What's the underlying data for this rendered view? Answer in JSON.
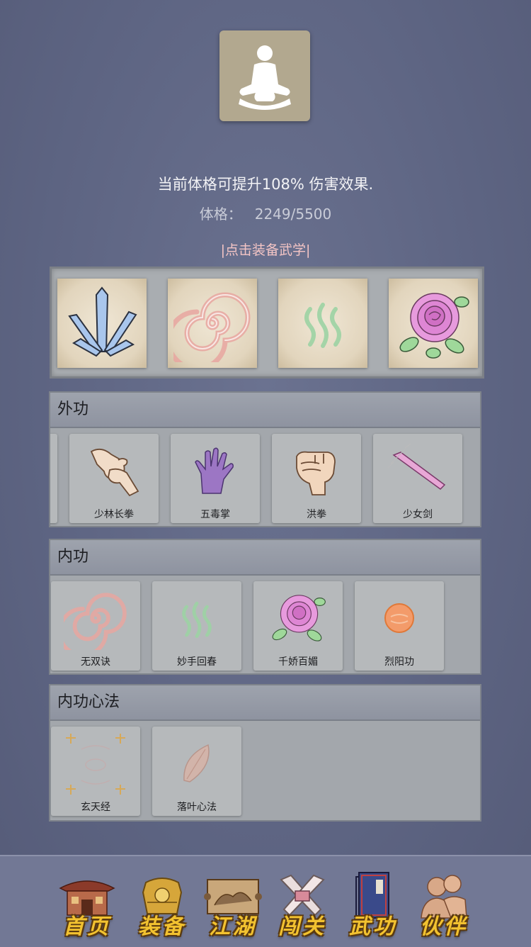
{
  "header": {
    "avatar_icon": "meditation-figure-icon",
    "description": "当前体格可提升108% 伤害效果.",
    "stat_label": "体格：",
    "stat_value": "2249/5500",
    "equip_hint": "|点击装备武学|"
  },
  "equipped_slots": [
    {
      "icon": "crystal-blades-icon"
    },
    {
      "icon": "swirl-icon"
    },
    {
      "icon": "green-waves-icon"
    },
    {
      "icon": "rose-icon"
    }
  ],
  "sections": {
    "waigong": {
      "title": "外功",
      "items": [
        {
          "name": "少林长拳",
          "icon": "grabbing-hands-icon"
        },
        {
          "name": "五毒掌",
          "icon": "purple-palm-icon"
        },
        {
          "name": "洪拳",
          "icon": "fist-icon"
        },
        {
          "name": "少女剑",
          "icon": "pink-sword-icon"
        }
      ]
    },
    "neigong": {
      "title": "内功",
      "items": [
        {
          "name": "无双诀",
          "icon": "swirl-icon"
        },
        {
          "name": "妙手回春",
          "icon": "green-waves-icon"
        },
        {
          "name": "千娇百媚",
          "icon": "rose-icon"
        },
        {
          "name": "烈阳功",
          "icon": "sun-orb-icon"
        }
      ]
    },
    "xinfa": {
      "title": "内功心法",
      "items": [
        {
          "name": "玄天经",
          "icon": "faded-frame-icon"
        },
        {
          "name": "落叶心法",
          "icon": "leaf-icon"
        }
      ]
    }
  },
  "bottom_nav": [
    {
      "label": "首页",
      "icon": "temple-icon"
    },
    {
      "label": "装备",
      "icon": "armor-icon"
    },
    {
      "label": "江湖",
      "icon": "scroll-map-icon"
    },
    {
      "label": "闯关",
      "icon": "crossed-blades-icon"
    },
    {
      "label": "武功",
      "icon": "book-icon"
    },
    {
      "label": "伙伴",
      "icon": "companions-icon"
    }
  ],
  "colors": {
    "background": "#5f6685",
    "panel": "#a3a7ac",
    "nav_text": "#f2c230",
    "hint_text": "#f4c5c5"
  }
}
